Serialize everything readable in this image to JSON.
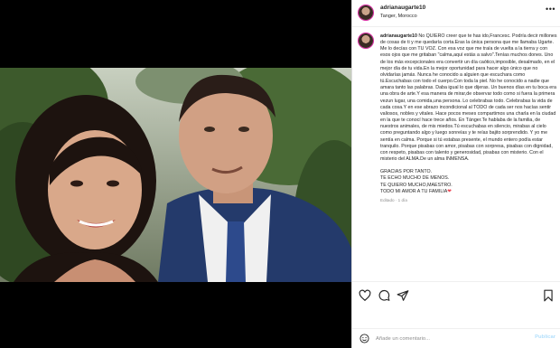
{
  "post": {
    "username": "adrianaugarte10",
    "location": "Tanger, Morocco",
    "more_icon": "•••"
  },
  "caption": {
    "username": "adrianaugarte10",
    "body": "No QUIERO creer que te has ido,Francesc. Podría decir millones de cosas de ti y me quedaría corta.Eras la única persona que me llamaba Ugarte. Me lo decías con TU VOZ. Con esa voz que me traía de vuelta a la tierra y con esos ojos que me gritaban \"calma,aquí estás a salvo\".Tenías muchos dones. Uno de los más excepcionales era convertir un día caótico,imposible, desalmado, en el mejor día de tu vida.En la mejor oportunidad para hacer algo único que no olvidarías jamás. Nunca he conocido a alguien que escuchara como tú.Escuchabas con todo el cuerpo.Con toda la piel. No he conocido a nadie que amara tanto las palabras. Daba igual lo que dijeras. Un buenos días en tu boca era una obra de arte.Y esa manera de mirar,de observar todo como si fuera la primera vezun lugar, una comida,una persona. Lo celebrabas todo. Celebrabas la vida de cada cosa.Y en ese abrazo incondicional al TODO de cada ser nos hacías sentir valiosos, nobles y vitales. Hace pocos meses compartimos una charla en la ciudad en la que te conocí hace trece años. En Tánger.Te hablaba de la familia, de nuestros animales, de mis miedos.Tú escuchabas en silencio, mirabas al cielo como preguntando algo y luego sonreías y te reías bajito sorprendido. Y yo me sentía en calma. Porque si tú estabas presente, el mundo entero podía estar tranquilo. Porque pisabas con amor, pisabas con sorpresa, pisabas con dignidad, con respeto, pisabas con talento y generosidad, pisabas con misterio. Con el misterio del ALMA.De un alma INMENSA.",
    "closing": "GRACIAS POR TANTO.\nTE ECHO MUCHO DE MENOS.\nTE QUIERO MUCHO,MAESTRO.\nTODO MI AMOR A TU FAMILIA",
    "closing_emoji": "❤",
    "meta": "Editado · 1 día"
  },
  "actions": {
    "icons": [
      "heart-icon",
      "comment-icon",
      "share-icon",
      "bookmark-icon"
    ]
  },
  "comment": {
    "placeholder": "Añade un comentario...",
    "publish_label": "Publicar"
  }
}
